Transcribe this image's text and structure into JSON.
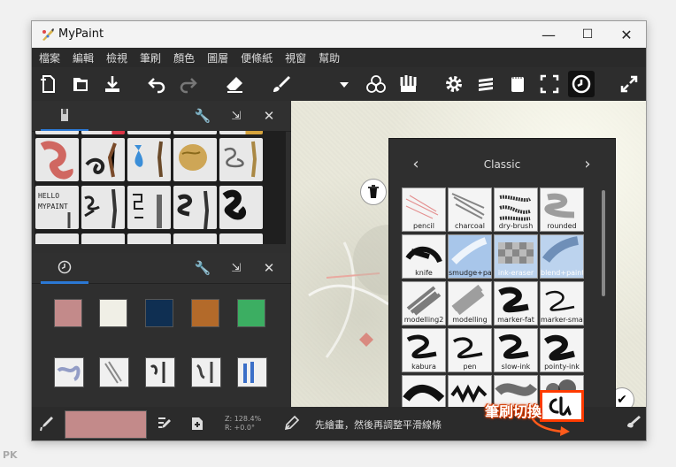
{
  "window": {
    "title": "MyPaint",
    "min": "—",
    "max": "☐",
    "close": "✕"
  },
  "menu": [
    "檔案",
    "編輯",
    "檢視",
    "筆刷",
    "顏色",
    "圖層",
    "便條紙",
    "視窗",
    "幫助"
  ],
  "brush_popup": {
    "title": "Classic",
    "prev": "‹",
    "next": "›",
    "items": [
      {
        "label": "pencil"
      },
      {
        "label": "charcoal"
      },
      {
        "label": "dry-brush"
      },
      {
        "label": "rounded"
      },
      {
        "label": "knife"
      },
      {
        "label": "smudge+paint"
      },
      {
        "label": "ink-eraser"
      },
      {
        "label": "blend+paint"
      },
      {
        "label": "modelling2"
      },
      {
        "label": "modelling"
      },
      {
        "label": "marker-fat"
      },
      {
        "label": "marker-small"
      },
      {
        "label": "kabura"
      },
      {
        "label": "pen"
      },
      {
        "label": "slow-ink"
      },
      {
        "label": "pointy-ink"
      }
    ]
  },
  "colors": [
    "#c38a8a",
    "#f0efe6",
    "#0f2f52",
    "#b36a2a",
    "#3cae62"
  ],
  "status": {
    "color": "#c38a8a",
    "zoom": "Z: 128.4%",
    "rotation": "R: +0.0°",
    "hint": "先繪畫，然後再調整平滑線條"
  },
  "annotation": "筆刷切換",
  "watermark": "PK"
}
